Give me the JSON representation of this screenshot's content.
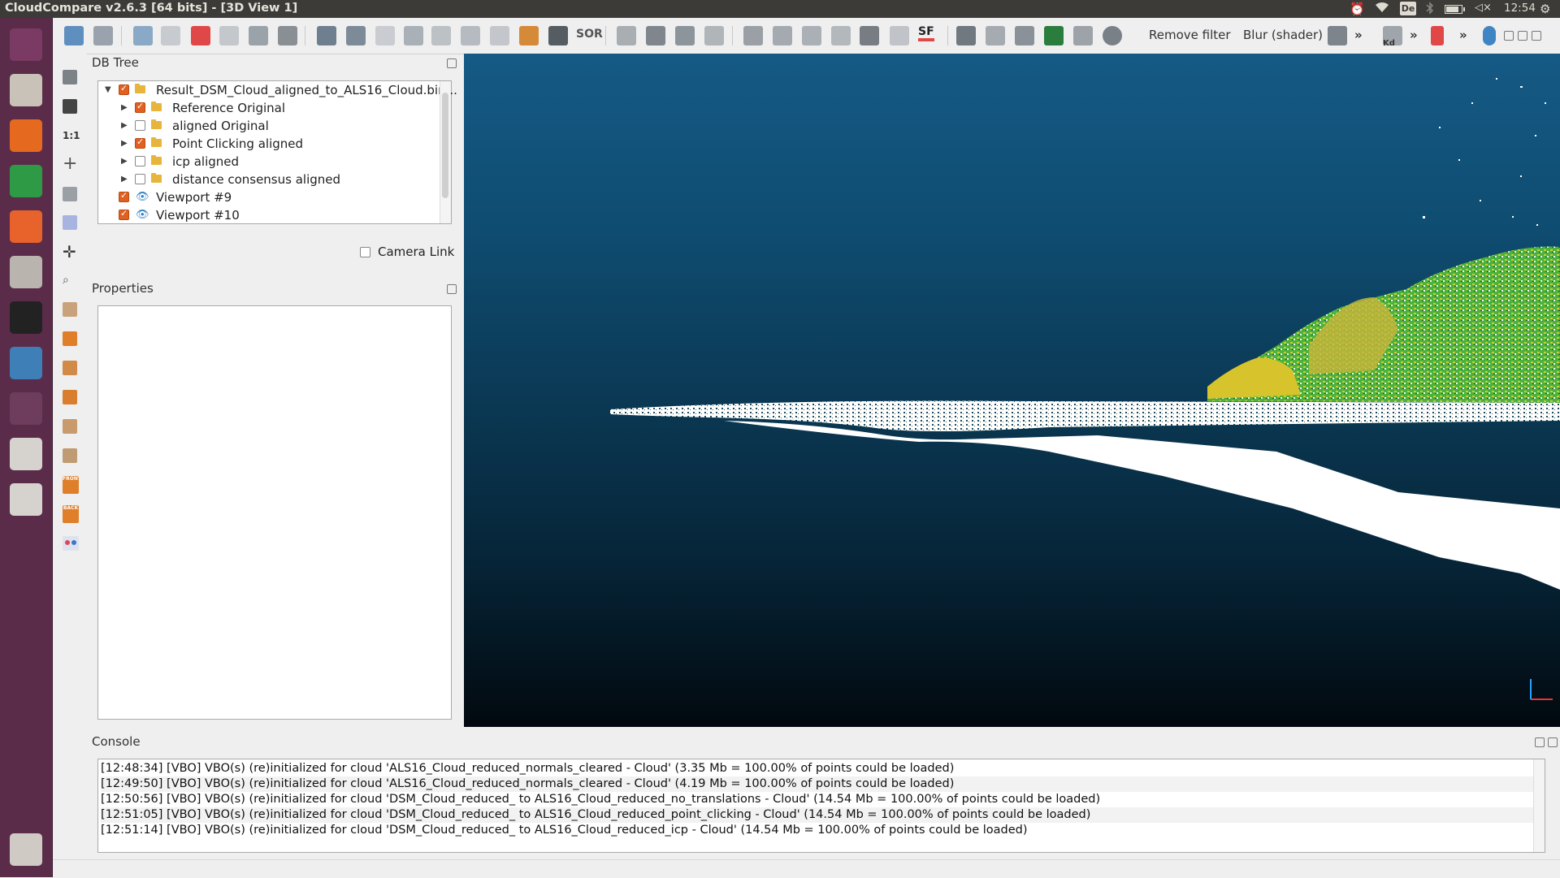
{
  "topbar": {
    "title": "CloudCompare v2.6.3 [64 bits] - [3D View 1]",
    "keyboard_layout": "De",
    "volume_label": "◁×",
    "clock": "12:54"
  },
  "launcher": {
    "items": [
      {
        "name": "ubuntu-dash-icon",
        "color": "#7b3a63"
      },
      {
        "name": "files-icon",
        "color": "#c9c2b8"
      },
      {
        "name": "firefox-icon",
        "color": "#e56a1f"
      },
      {
        "name": "libreoffice-calc-icon",
        "color": "#2f9a45"
      },
      {
        "name": "software-center-icon",
        "color": "#e8622c"
      },
      {
        "name": "system-settings-icon",
        "color": "#b9b4ae"
      },
      {
        "name": "amazon-icon",
        "color": "#222222"
      },
      {
        "name": "cloudcompare-icon",
        "color": "#3f7fb8"
      },
      {
        "name": "workspace-switcher-icon",
        "color": "#6e3c5d"
      },
      {
        "name": "drive-icon",
        "color": "#d6d3cf"
      },
      {
        "name": "drive-2-icon",
        "color": "#d6d3cf"
      },
      {
        "name": "trash-icon",
        "color": "#cfcac3"
      }
    ]
  },
  "toolbar": {
    "remove_filter_label": "Remove filter",
    "blur_shader_label": "Blur (shader)",
    "sor_label": "SOR",
    "sf_label": "SF",
    "kd_label": "Kd",
    "more_label": "»"
  },
  "lefttools": {
    "one_to_one_label": "1:1",
    "front_label": "FRONT",
    "back_label": "BACK"
  },
  "dbtree": {
    "title": "DB Tree",
    "rows": [
      {
        "label": "Result_DSM_Cloud_aligned_to_ALS16_Cloud.bin...",
        "checked": true
      },
      {
        "label": "Reference Original",
        "checked": true
      },
      {
        "label": "aligned Original",
        "checked": false
      },
      {
        "label": "Point Clicking aligned",
        "checked": true
      },
      {
        "label": "icp aligned",
        "checked": false
      },
      {
        "label": "distance consensus aligned",
        "checked": false
      },
      {
        "label": "Viewport #9",
        "checked": true
      },
      {
        "label": "Viewport #10",
        "checked": true
      }
    ],
    "camera_link_label": "Camera Link"
  },
  "properties": {
    "title": "Properties"
  },
  "console": {
    "title": "Console",
    "lines": [
      "[12:48:34] [VBO] VBO(s) (re)initialized for cloud 'ALS16_Cloud_reduced_normals_cleared - Cloud' (3.35 Mb = 100.00% of points could be loaded)",
      "[12:49:50] [VBO] VBO(s) (re)initialized for cloud 'ALS16_Cloud_reduced_normals_cleared - Cloud' (4.19 Mb = 100.00% of points could be loaded)",
      "[12:50:56] [VBO] VBO(s) (re)initialized for cloud 'DSM_Cloud_reduced_ to ALS16_Cloud_reduced_no_translations - Cloud' (14.54 Mb = 100.00% of points could be loaded)",
      "[12:51:05] [VBO] VBO(s) (re)initialized for cloud 'DSM_Cloud_reduced_ to ALS16_Cloud_reduced_point_clicking - Cloud' (14.54 Mb = 100.00% of points could be loaded)",
      "[12:51:14] [VBO] VBO(s) (re)initialized for cloud 'DSM_Cloud_reduced_ to ALS16_Cloud_reduced_icp - Cloud' (14.54 Mb = 100.00% of points could be loaded)"
    ]
  }
}
